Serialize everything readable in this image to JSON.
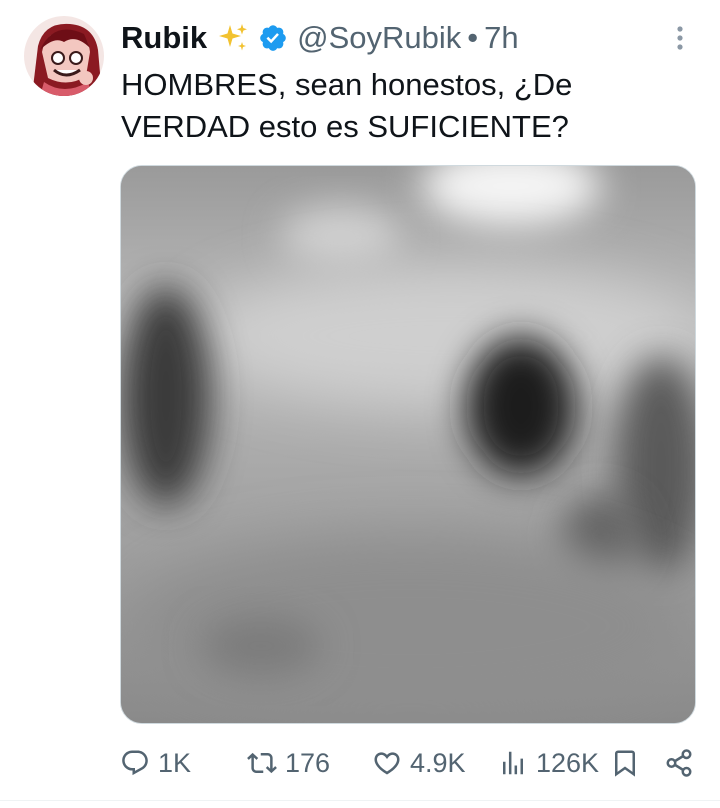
{
  "user": {
    "display_name": "Rubik",
    "name_emoji": "sparkles",
    "verified": true,
    "handle": "@SoyRubik",
    "separator": "•",
    "time": "7h",
    "avatar_icon": "avatar-cartoon-character"
  },
  "tweet": {
    "text_lines": [
      "HOMBRES, sean honestos, ¿De",
      "VERDAD esto es SUFICIENTE?"
    ]
  },
  "media": {
    "description_icon": "blurred-photo",
    "blurred": true
  },
  "actions": {
    "reply": {
      "icon": "reply-icon",
      "count": "1K"
    },
    "retweet": {
      "icon": "retweet-icon",
      "count": "176"
    },
    "like": {
      "icon": "heart-icon",
      "count": "4.9K"
    },
    "views": {
      "icon": "analytics-icon",
      "count": "126K"
    },
    "bookmark": {
      "icon": "bookmark-icon"
    },
    "share": {
      "icon": "share-icon"
    }
  },
  "colors": {
    "verified_blue": "#1d9bf0",
    "secondary_text": "#536471",
    "primary_text": "#0f1419",
    "sparkle_yellow": "#f2c230"
  }
}
